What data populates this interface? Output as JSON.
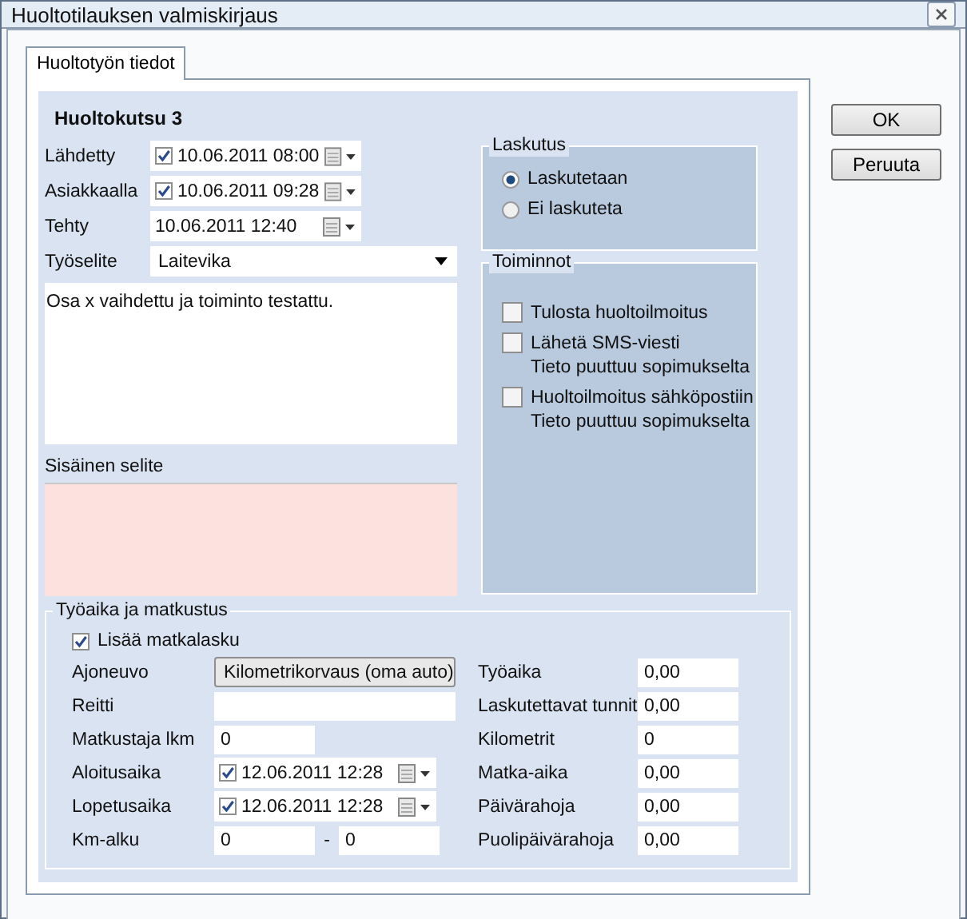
{
  "window": {
    "title": "Huoltotilauksen valmiskirjaus"
  },
  "tabs": [
    {
      "label": "Huoltotyön tiedot",
      "selected": true
    }
  ],
  "heading": "Huoltokutsu 3",
  "date_fields": [
    {
      "label": "Lähdetty",
      "kind": "check-date",
      "checked": true,
      "value": "10.06.2011 08:00"
    },
    {
      "label": "Asiakkaalla",
      "kind": "check-date",
      "checked": true,
      "value": "10.06.2011 09:28"
    },
    {
      "label": "Tehty",
      "kind": "date",
      "value": "10.06.2011 12:40"
    }
  ],
  "work_description": {
    "label": "Työselite",
    "value": "Laitevika",
    "text": "Osa x vaihdettu ja toiminto testattu."
  },
  "internal_note": {
    "label": "Sisäinen selite"
  },
  "billing": {
    "title": "Laskutus",
    "options": [
      {
        "label": "Laskutetaan",
        "selected": true
      },
      {
        "label": "Ei laskuteta",
        "selected": false
      }
    ]
  },
  "actions": {
    "title": "Toiminnot",
    "items": [
      {
        "label": "Tulosta huoltoilmoitus",
        "checked": false
      },
      {
        "label": "Lähetä SMS-viesti",
        "checked": false,
        "note": "Tieto puuttuu sopimukselta"
      },
      {
        "label": "Huoltoilmoitus sähköpostiin",
        "checked": false,
        "note": "Tieto puuttuu sopimukselta"
      }
    ]
  },
  "travel": {
    "title": "Työaika ja matkustus",
    "add_travel": {
      "label": "Lisää matkalasku",
      "checked": true
    },
    "left_rows": [
      {
        "label": "Ajoneuvo",
        "kind": "select",
        "value": "Kilometrikorvaus (oma auto)"
      },
      {
        "label": "Reitti",
        "kind": "text"
      },
      {
        "label": "Matkustaja lkm",
        "kind": "short",
        "value": "0"
      },
      {
        "label": "Aloitusaika",
        "kind": "check-date",
        "checked": true,
        "value": "12.06.2011 12:28"
      },
      {
        "label": "Lopetusaika",
        "kind": "check-date",
        "checked": true,
        "value": "12.06.2011 12:28"
      },
      {
        "label": "Km-alku",
        "kind": "range",
        "value": "0",
        "separator": "-",
        "value_to": "0"
      }
    ],
    "right_rows": [
      {
        "label": "Työaika",
        "value": "0,00"
      },
      {
        "label": "Laskutettavat tunnit",
        "value": "0,00"
      },
      {
        "label": "Kilometrit",
        "value": "0"
      },
      {
        "label": "Matka-aika",
        "value": "0,00"
      },
      {
        "label": "Päivärahoja",
        "value": "0,00"
      },
      {
        "label": "Puolipäivärahoja",
        "value": "0,00"
      }
    ]
  },
  "buttons": [
    "OK",
    "Peruuta"
  ]
}
